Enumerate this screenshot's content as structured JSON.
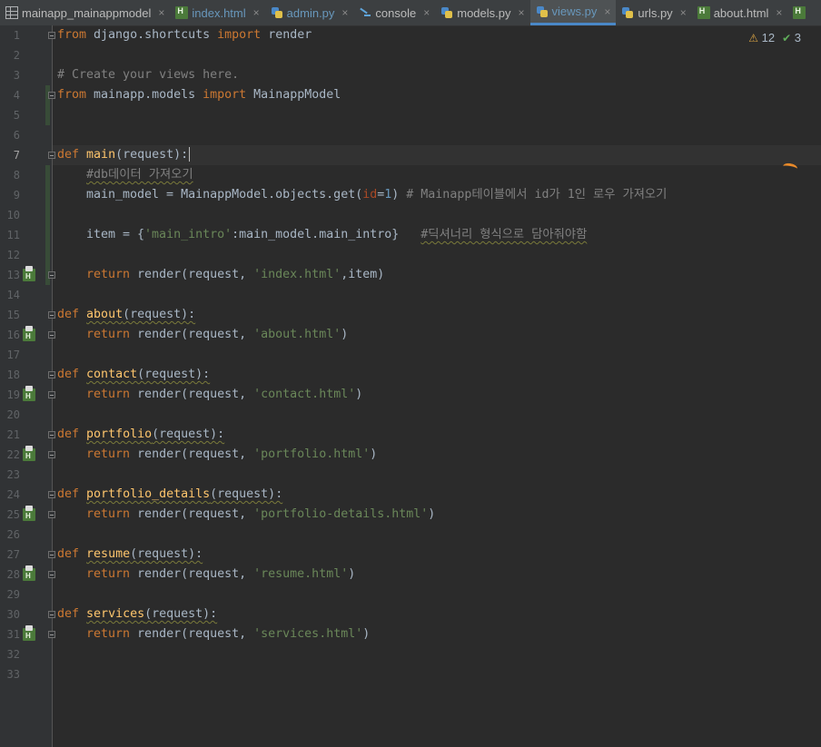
{
  "tabs": [
    {
      "label": "mainapp_mainappmodel",
      "icon": "table-icon",
      "active": false
    },
    {
      "label": "index.html",
      "icon": "html-file-icon",
      "active": false
    },
    {
      "label": "admin.py",
      "icon": "python-file-icon",
      "active": false
    },
    {
      "label": "console",
      "icon": "console-icon",
      "active": false
    },
    {
      "label": "models.py",
      "icon": "python-file-icon",
      "active": false
    },
    {
      "label": "views.py",
      "icon": "python-file-icon",
      "active": true
    },
    {
      "label": "urls.py",
      "icon": "python-file-icon",
      "active": false
    },
    {
      "label": "about.html",
      "icon": "html-file-icon",
      "active": false
    }
  ],
  "tab_close_glyph": "×",
  "inspections": {
    "warnings": "12",
    "ok": "3"
  },
  "line_numbers": [
    "1",
    "2",
    "3",
    "4",
    "5",
    "6",
    "7",
    "8",
    "9",
    "10",
    "11",
    "12",
    "13",
    "14",
    "15",
    "16",
    "17",
    "18",
    "19",
    "20",
    "21",
    "22",
    "23",
    "24",
    "25",
    "26",
    "27",
    "28",
    "29",
    "30",
    "31",
    "32",
    "33"
  ],
  "code": {
    "l1": {
      "kw1": "from",
      "t1": " django.shortcuts ",
      "kw2": "import",
      "t2": " render"
    },
    "l3": {
      "cmt": "# Create your views here."
    },
    "l4": {
      "kw1": "from",
      "t1": " mainapp.models ",
      "kw2": "import",
      "t2": " MainappModel"
    },
    "l7": {
      "kw": "def",
      "fn": "main",
      "t": "(request):"
    },
    "l8": {
      "cmt": "#db데이터 가져오기"
    },
    "l9": {
      "t1": "main_model = MainappModel.objects.get(",
      "p": "id",
      "t2": "=",
      "n": "1",
      "t3": ") ",
      "cmt": "# Mainapp테이블에서 id가 1인 로우 가져오기"
    },
    "l11": {
      "t1": "item = {",
      "s": "'main_intro'",
      "t2": ":main_model.main_intro}   ",
      "cmt": "#딕셔너리 형식으로 담아줘야함"
    },
    "l13": {
      "kw": "return",
      "t1": " render(request, ",
      "s": "'index.html'",
      "t2": ",item)"
    },
    "l15": {
      "kw": "def",
      "fn": "about",
      "t": "(request):"
    },
    "l16": {
      "kw": "return",
      "t1": " render(request, ",
      "s": "'about.html'",
      "t2": ")"
    },
    "l18": {
      "kw": "def",
      "fn": "contact",
      "t": "(request):"
    },
    "l19": {
      "kw": "return",
      "t1": " render(request, ",
      "s": "'contact.html'",
      "t2": ")"
    },
    "l21": {
      "kw": "def",
      "fn": "portfolio",
      "t": "(request):"
    },
    "l22": {
      "kw": "return",
      "t1": " render(request, ",
      "s": "'portfolio.html'",
      "t2": ")"
    },
    "l24": {
      "kw": "def",
      "fn": "portfolio_details",
      "t": "(request):"
    },
    "l25": {
      "kw": "return",
      "t1": " render(request, ",
      "s": "'portfolio-details.html'",
      "t2": ")"
    },
    "l27": {
      "kw": "def",
      "fn": "resume",
      "t": "(request):"
    },
    "l28": {
      "kw": "return",
      "t1": " render(request, ",
      "s": "'resume.html'",
      "t2": ")"
    },
    "l30": {
      "kw": "def",
      "fn": "services",
      "t": "(request):"
    },
    "l31": {
      "kw": "return",
      "t1": " render(request, ",
      "s": "'services.html'",
      "t2": ")"
    }
  },
  "colors": {
    "keyword": "#cc7832",
    "function": "#ffc66d",
    "string": "#6a8759",
    "comment": "#808080",
    "number": "#6897bb",
    "active_tab_underline": "#4a88c7"
  }
}
